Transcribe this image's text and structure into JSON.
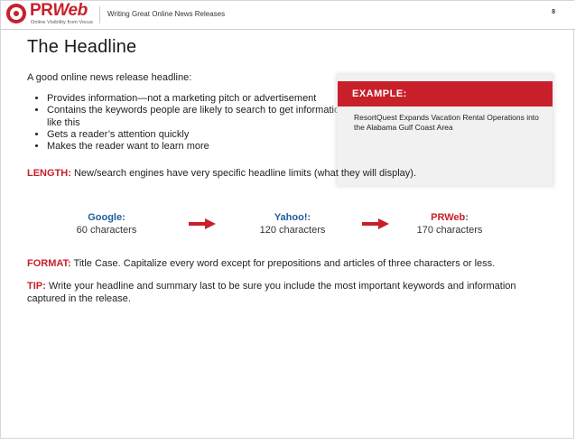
{
  "header": {
    "logo_pr": "PR",
    "logo_web": "Web",
    "logo_tagline": "Online Visibility from Vocus",
    "title": "Writing Great Online News Releases",
    "page_number": "8"
  },
  "title": "The Headline",
  "intro": "A good online news release headline:",
  "bullets": [
    "Provides information—not a marketing pitch or advertisement",
    "Contains the keywords people are likely to search to get information like this",
    "Gets a reader’s attention quickly",
    "Makes the reader want to learn more"
  ],
  "length": {
    "label": "LENGTH:",
    "text": " New/search engines have very specific headline limits (what they will display)."
  },
  "example": {
    "heading": "EXAMPLE:",
    "text": "ResortQuest Expands Vacation Rental Operations into the Alabama Gulf Coast Area"
  },
  "engines": [
    {
      "name": "Google:",
      "chars": "60 characters"
    },
    {
      "name": "Yahoo!:",
      "chars": "120 characters"
    },
    {
      "name_main": "PRWeb",
      "name_colon": ":",
      "chars": "170 characters"
    }
  ],
  "format": {
    "label": "FORMAT:",
    "text": " Title Case. Capitalize every word except for prepositions and articles of three characters or less."
  },
  "tip": {
    "label": "TIP:",
    "text": " Write your headline and summary last to be sure you include the most important keywords and information captured in the release."
  },
  "colors": {
    "brand_red": "#c8202b",
    "engine_blue": "#1f5f9c"
  }
}
